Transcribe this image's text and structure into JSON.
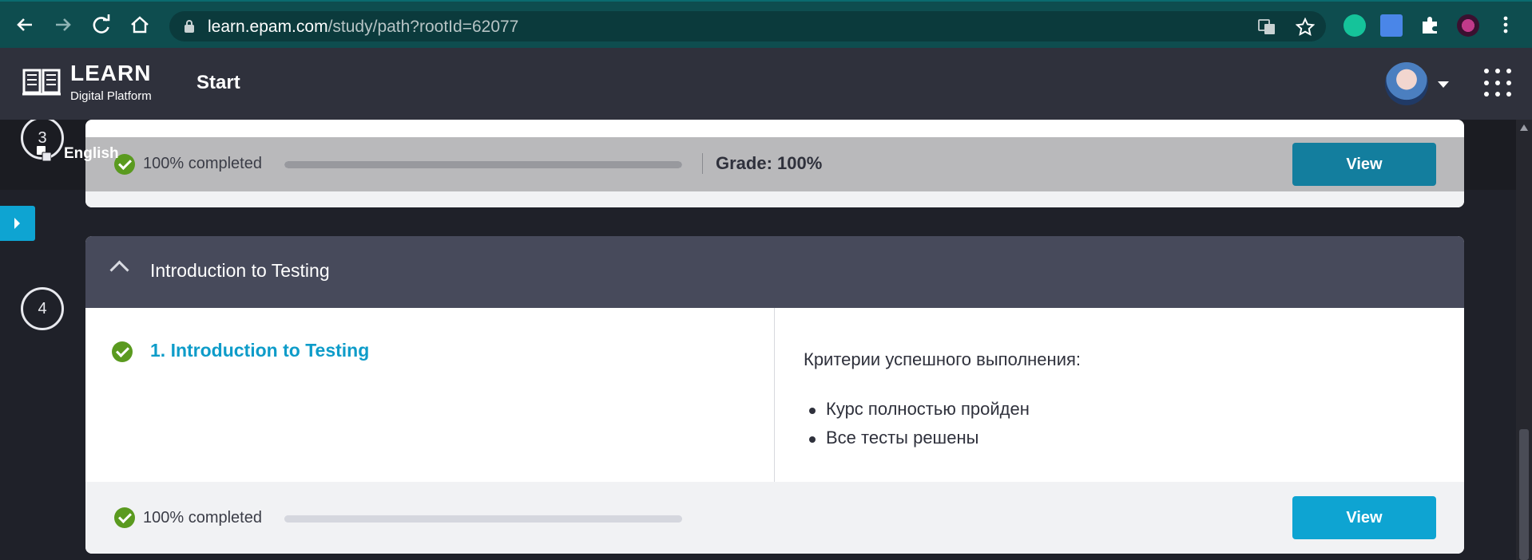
{
  "browser": {
    "url_host": "learn.epam.com",
    "url_path": "/study/path?rootId=62077"
  },
  "header": {
    "logo_title": "LEARN",
    "logo_subtitle": "Digital Platform",
    "nav_start": "Start"
  },
  "sidebar": {
    "language": "English",
    "steps": [
      "3",
      "4"
    ]
  },
  "section3": {
    "progress_text": "100% completed",
    "progress": 1.0,
    "grade": "Grade: 100%",
    "button": "View"
  },
  "section4": {
    "title": "Introduction to Testing",
    "lesson": "1. Introduction to Testing",
    "criteria_title": "Критерии успешного выполнения:",
    "criteria": [
      "Курс полностью пройден",
      "Все тесты решены"
    ],
    "progress_text": "100% completed",
    "progress": 1.0,
    "button": "View"
  },
  "colors": {
    "accent": "#0ea4d2",
    "success": "#5a9a1f",
    "header_bg": "#2f313c",
    "section_head": "#474a5b"
  },
  "icons": [
    "back-icon",
    "forward-icon",
    "reload-icon",
    "home-icon",
    "lock-icon",
    "translate-icon",
    "star-icon",
    "grammarly-icon",
    "v-extension-icon",
    "puzzle-icon",
    "profile-icon",
    "more-vert-icon",
    "book-logo-icon",
    "chevron-down-icon",
    "apps-grid-icon",
    "check-circle-icon",
    "chevron-up-icon",
    "expand-arrow-icon"
  ]
}
